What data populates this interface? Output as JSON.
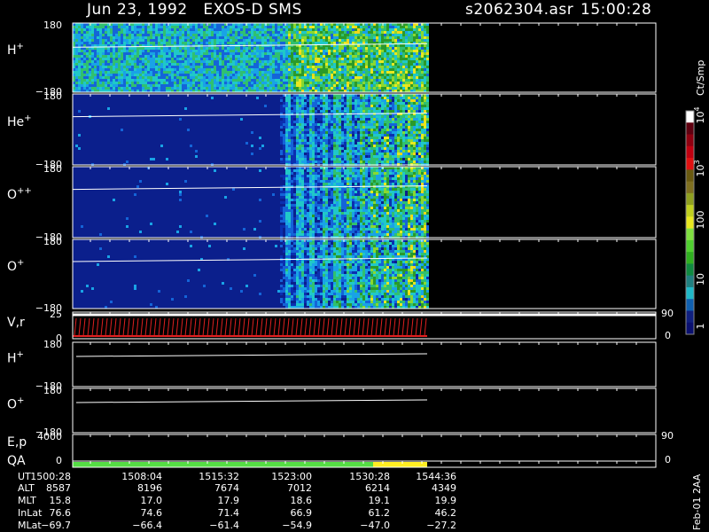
{
  "header": {
    "title": "Jun 23, 1992   EXOS-D SMS",
    "file": "s2062304.asr",
    "time": "15:00:28"
  },
  "colorbar": {
    "units": "Ct/Smp",
    "labels": [
      "1",
      "10",
      "100",
      "10",
      "10"
    ],
    "label_exponents": [
      "",
      "",
      "",
      "3",
      "4"
    ]
  },
  "chart_data": [
    {
      "type": "heatmap",
      "ylabel": "H",
      "ylabel_sup": "+",
      "ylim": [
        -180,
        180
      ],
      "ticks": [
        "180",
        "−180"
      ]
    },
    {
      "type": "heatmap",
      "ylabel": "He",
      "ylabel_sup": "+",
      "ylim": [
        -180,
        180
      ],
      "ticks": [
        "180",
        "−180"
      ]
    },
    {
      "type": "heatmap",
      "ylabel": "O",
      "ylabel_sup": "++",
      "ylim": [
        -180,
        180
      ],
      "ticks": [
        "180",
        "−180"
      ]
    },
    {
      "type": "heatmap",
      "ylabel": "O",
      "ylabel_sup": "+",
      "ylim": [
        -180,
        180
      ],
      "ticks": [
        "180",
        "−180"
      ]
    },
    {
      "type": "line",
      "ylabel": "V,r",
      "ylim": [
        0,
        25
      ],
      "ticks": [
        "25",
        "0"
      ],
      "right_ticks": [
        "90",
        "0"
      ]
    },
    {
      "type": "line",
      "ylabel": "H",
      "ylabel_sup": "+",
      "ylim": [
        -180,
        180
      ],
      "ticks": [
        "180",
        "−180"
      ]
    },
    {
      "type": "line",
      "ylabel": "O",
      "ylabel_sup": "+",
      "ylim": [
        -180,
        180
      ],
      "ticks": [
        "180",
        "−180"
      ]
    },
    {
      "type": "line",
      "ylabel": "E,p",
      "ylim": [
        0,
        4000
      ],
      "ticks": [
        "4000",
        "0"
      ],
      "right_ticks": [
        "90",
        "0"
      ]
    },
    {
      "type": "bar",
      "ylabel": "QA",
      "segments": [
        {
          "start": "1500:28",
          "end": "1530:28",
          "color": "#55dd44"
        },
        {
          "start": "1530:28",
          "end": "1544:36",
          "color": "#ffee22"
        }
      ]
    }
  ],
  "footer": {
    "row_labels": [
      "UT",
      "ALT",
      "MLT",
      "InLat",
      "MLat"
    ],
    "columns": [
      {
        "UT": "1500:28",
        "ALT": "8587",
        "MLT": "15.8",
        "InLat": "76.6",
        "MLat": "−69.7"
      },
      {
        "UT": "1508:04",
        "ALT": "8196",
        "MLT": "17.0",
        "InLat": "74.6",
        "MLat": "−66.4"
      },
      {
        "UT": "1515:32",
        "ALT": "7674",
        "MLT": "17.9",
        "InLat": "71.4",
        "MLat": "−61.4"
      },
      {
        "UT": "1523:00",
        "ALT": "7012",
        "MLT": "18.6",
        "InLat": "66.9",
        "MLat": "−54.9"
      },
      {
        "UT": "1530:28",
        "ALT": "6214",
        "MLT": "19.1",
        "InLat": "61.2",
        "MLat": "−47.0"
      },
      {
        "UT": "1544:36",
        "ALT": "4349",
        "MLT": "19.9",
        "InLat": "46.2",
        "MLat": "−27.2"
      }
    ],
    "stamp": "Feb-01 2AA"
  }
}
